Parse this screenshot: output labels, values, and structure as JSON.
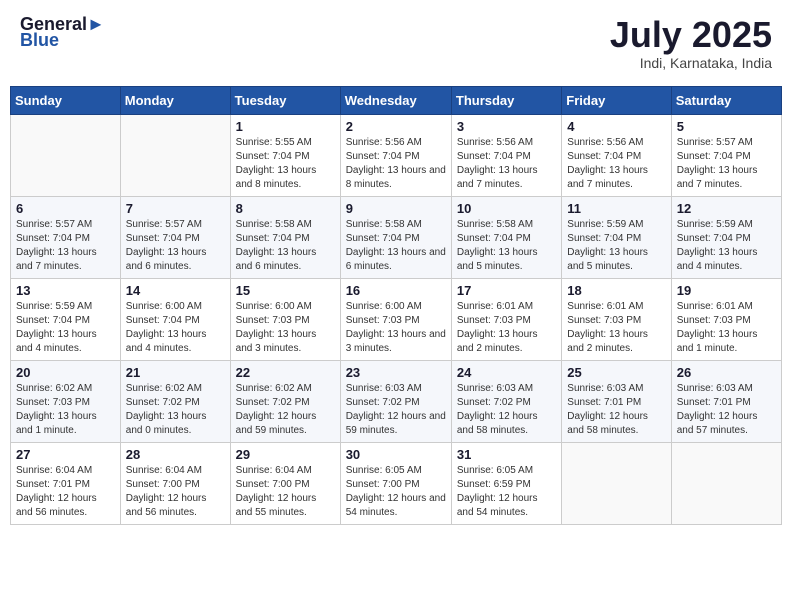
{
  "header": {
    "logo_text1": "General",
    "logo_text2": "Blue",
    "month": "July 2025",
    "location": "Indi, Karnataka, India"
  },
  "weekdays": [
    "Sunday",
    "Monday",
    "Tuesday",
    "Wednesday",
    "Thursday",
    "Friday",
    "Saturday"
  ],
  "weeks": [
    [
      {
        "day": "",
        "info": ""
      },
      {
        "day": "",
        "info": ""
      },
      {
        "day": "1",
        "info": "Sunrise: 5:55 AM\nSunset: 7:04 PM\nDaylight: 13 hours and 8 minutes."
      },
      {
        "day": "2",
        "info": "Sunrise: 5:56 AM\nSunset: 7:04 PM\nDaylight: 13 hours and 8 minutes."
      },
      {
        "day": "3",
        "info": "Sunrise: 5:56 AM\nSunset: 7:04 PM\nDaylight: 13 hours and 7 minutes."
      },
      {
        "day": "4",
        "info": "Sunrise: 5:56 AM\nSunset: 7:04 PM\nDaylight: 13 hours and 7 minutes."
      },
      {
        "day": "5",
        "info": "Sunrise: 5:57 AM\nSunset: 7:04 PM\nDaylight: 13 hours and 7 minutes."
      }
    ],
    [
      {
        "day": "6",
        "info": "Sunrise: 5:57 AM\nSunset: 7:04 PM\nDaylight: 13 hours and 7 minutes."
      },
      {
        "day": "7",
        "info": "Sunrise: 5:57 AM\nSunset: 7:04 PM\nDaylight: 13 hours and 6 minutes."
      },
      {
        "day": "8",
        "info": "Sunrise: 5:58 AM\nSunset: 7:04 PM\nDaylight: 13 hours and 6 minutes."
      },
      {
        "day": "9",
        "info": "Sunrise: 5:58 AM\nSunset: 7:04 PM\nDaylight: 13 hours and 6 minutes."
      },
      {
        "day": "10",
        "info": "Sunrise: 5:58 AM\nSunset: 7:04 PM\nDaylight: 13 hours and 5 minutes."
      },
      {
        "day": "11",
        "info": "Sunrise: 5:59 AM\nSunset: 7:04 PM\nDaylight: 13 hours and 5 minutes."
      },
      {
        "day": "12",
        "info": "Sunrise: 5:59 AM\nSunset: 7:04 PM\nDaylight: 13 hours and 4 minutes."
      }
    ],
    [
      {
        "day": "13",
        "info": "Sunrise: 5:59 AM\nSunset: 7:04 PM\nDaylight: 13 hours and 4 minutes."
      },
      {
        "day": "14",
        "info": "Sunrise: 6:00 AM\nSunset: 7:04 PM\nDaylight: 13 hours and 4 minutes."
      },
      {
        "day": "15",
        "info": "Sunrise: 6:00 AM\nSunset: 7:03 PM\nDaylight: 13 hours and 3 minutes."
      },
      {
        "day": "16",
        "info": "Sunrise: 6:00 AM\nSunset: 7:03 PM\nDaylight: 13 hours and 3 minutes."
      },
      {
        "day": "17",
        "info": "Sunrise: 6:01 AM\nSunset: 7:03 PM\nDaylight: 13 hours and 2 minutes."
      },
      {
        "day": "18",
        "info": "Sunrise: 6:01 AM\nSunset: 7:03 PM\nDaylight: 13 hours and 2 minutes."
      },
      {
        "day": "19",
        "info": "Sunrise: 6:01 AM\nSunset: 7:03 PM\nDaylight: 13 hours and 1 minute."
      }
    ],
    [
      {
        "day": "20",
        "info": "Sunrise: 6:02 AM\nSunset: 7:03 PM\nDaylight: 13 hours and 1 minute."
      },
      {
        "day": "21",
        "info": "Sunrise: 6:02 AM\nSunset: 7:02 PM\nDaylight: 13 hours and 0 minutes."
      },
      {
        "day": "22",
        "info": "Sunrise: 6:02 AM\nSunset: 7:02 PM\nDaylight: 12 hours and 59 minutes."
      },
      {
        "day": "23",
        "info": "Sunrise: 6:03 AM\nSunset: 7:02 PM\nDaylight: 12 hours and 59 minutes."
      },
      {
        "day": "24",
        "info": "Sunrise: 6:03 AM\nSunset: 7:02 PM\nDaylight: 12 hours and 58 minutes."
      },
      {
        "day": "25",
        "info": "Sunrise: 6:03 AM\nSunset: 7:01 PM\nDaylight: 12 hours and 58 minutes."
      },
      {
        "day": "26",
        "info": "Sunrise: 6:03 AM\nSunset: 7:01 PM\nDaylight: 12 hours and 57 minutes."
      }
    ],
    [
      {
        "day": "27",
        "info": "Sunrise: 6:04 AM\nSunset: 7:01 PM\nDaylight: 12 hours and 56 minutes."
      },
      {
        "day": "28",
        "info": "Sunrise: 6:04 AM\nSunset: 7:00 PM\nDaylight: 12 hours and 56 minutes."
      },
      {
        "day": "29",
        "info": "Sunrise: 6:04 AM\nSunset: 7:00 PM\nDaylight: 12 hours and 55 minutes."
      },
      {
        "day": "30",
        "info": "Sunrise: 6:05 AM\nSunset: 7:00 PM\nDaylight: 12 hours and 54 minutes."
      },
      {
        "day": "31",
        "info": "Sunrise: 6:05 AM\nSunset: 6:59 PM\nDaylight: 12 hours and 54 minutes."
      },
      {
        "day": "",
        "info": ""
      },
      {
        "day": "",
        "info": ""
      }
    ]
  ]
}
